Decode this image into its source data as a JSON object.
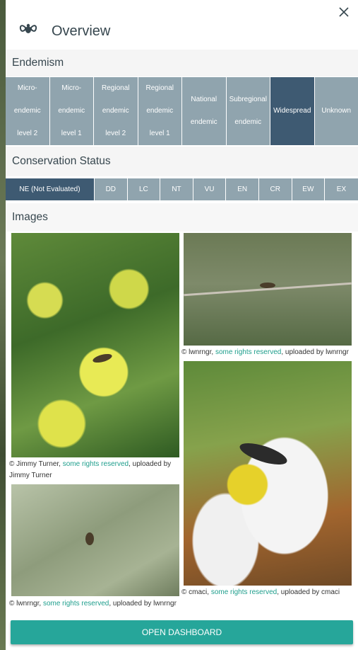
{
  "header": {
    "title": "Overview",
    "logo_icon": "fly-icon",
    "close_icon": "close-icon"
  },
  "endemism": {
    "title": "Endemism",
    "items": [
      {
        "label": "Micro-endemic level 2",
        "active": false
      },
      {
        "label": "Micro-endemic level 1",
        "active": false
      },
      {
        "label": "Regional endemic level 2",
        "active": false
      },
      {
        "label": "Regional endemic level 1",
        "active": false
      },
      {
        "label": "National endemic",
        "active": false
      },
      {
        "label": "Subregional endemic",
        "active": false
      },
      {
        "label": "Widespread",
        "active": true
      },
      {
        "label": "Unknown",
        "active": false
      }
    ]
  },
  "conservation": {
    "title": "Conservation Status",
    "items": [
      {
        "label": "NE (Not Evaluated)",
        "active": true
      },
      {
        "label": "DD",
        "active": false
      },
      {
        "label": "LC",
        "active": false
      },
      {
        "label": "NT",
        "active": false
      },
      {
        "label": "VU",
        "active": false
      },
      {
        "label": "EN",
        "active": false
      },
      {
        "label": "CR",
        "active": false
      },
      {
        "label": "EW",
        "active": false
      },
      {
        "label": "EX",
        "active": false
      }
    ]
  },
  "images": {
    "title": "Images",
    "items": [
      {
        "prefix": "© Jimmy Turner, ",
        "link": "some rights reserved",
        "suffix": ", uploaded by Jimmy Turner"
      },
      {
        "prefix": "© lwnrngr, ",
        "link": "some rights reserved",
        "suffix": ", uploaded by lwnrngr"
      },
      {
        "prefix": "© lwnrngr, ",
        "link": "some rights reserved",
        "suffix": ", uploaded by lwnrngr"
      },
      {
        "prefix": "© cmaci, ",
        "link": "some rights reserved",
        "suffix": ", uploaded by cmaci"
      }
    ]
  },
  "dashboard_button": {
    "label": "OPEN DASHBOARD"
  },
  "colors": {
    "accent": "#26a69a",
    "active": "#3e5a72",
    "inactive": "#90a4ae",
    "link": "#1e9e8c"
  }
}
